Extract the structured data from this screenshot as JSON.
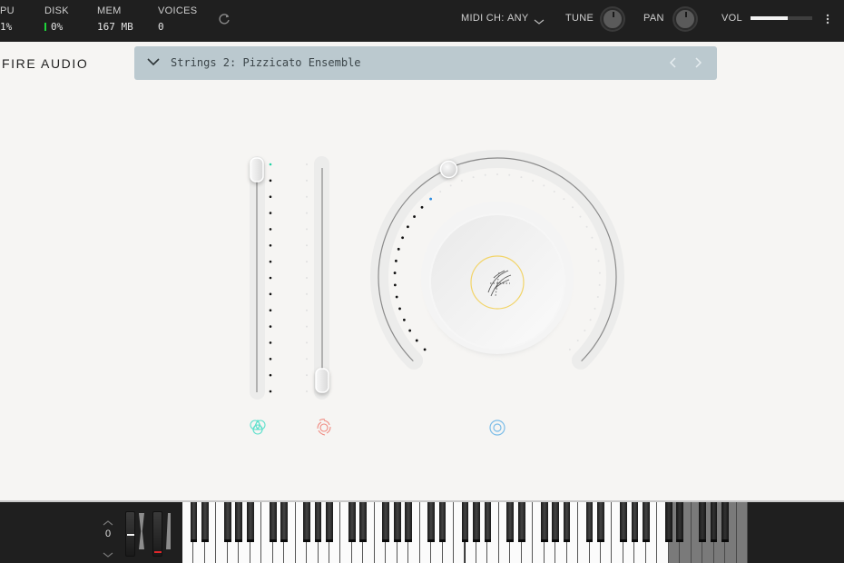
{
  "topbar": {
    "stats": [
      {
        "label": "PU",
        "value": "1%"
      },
      {
        "label": "DISK",
        "value": "0%"
      },
      {
        "label": "MEM",
        "value": "167 MB"
      },
      {
        "label": "VOICES",
        "value": "0"
      }
    ],
    "refresh_icon": "refresh-icon",
    "midi_label": "MIDI CH:",
    "midi_value": "ANY",
    "tune_label": "TUNE",
    "pan_label": "PAN",
    "vol_label": "VOL",
    "vol_level": 0.6,
    "menu_icon": "vertical-dots-icon",
    "disk_color": "#1ed43a"
  },
  "header": {
    "brand": "FIRE AUDIO",
    "preset_name": "Strings 2: Pizzicato Ensemble",
    "preset_bg": "#bbc9cf"
  },
  "controls": {
    "slider1": {
      "level": 1.0,
      "icon": "triangle-circles-icon",
      "icon_color": "#5fe0cc",
      "active_dot_color": "#22d3a5"
    },
    "slider2": {
      "level": 0.0,
      "icon": "aperture-swirl-icon",
      "icon_color": "#f08a80"
    },
    "ring": {
      "level": 0.35,
      "icon": "circle-target-icon",
      "icon_color": "#7cbde8",
      "active_dot_color": "#2a8be0",
      "center_icon": "strings-texture-icon",
      "center_ring_color": "#f2d468"
    }
  },
  "keyboard": {
    "octave": "0",
    "octave_up_icon": "chevron-up-icon",
    "octave_down_icon": "chevron-down-icon",
    "white_keys": 50,
    "active_range_white_keys": 43,
    "pitch_marker_color": "#f2f2f2",
    "mod_marker_color": "#e0262a"
  }
}
